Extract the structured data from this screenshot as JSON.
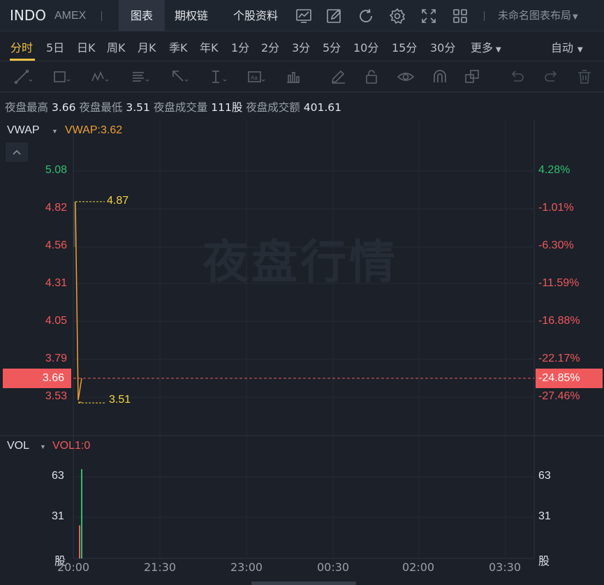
{
  "header": {
    "ticker": "INDO",
    "exchange": "AMEX",
    "tab_chart": "图表",
    "tab_options": "期权链",
    "tab_info": "个股资料",
    "icons": [
      "chart-line-icon",
      "pen-icon",
      "refresh-icon",
      "gear-icon",
      "fullscreen-icon",
      "grid-icon"
    ],
    "layout_label": "未命名图表布局"
  },
  "periods": {
    "items": [
      "分时",
      "5日",
      "日K",
      "周K",
      "月K",
      "季K",
      "年K",
      "1分",
      "2分",
      "3分",
      "5分",
      "10分",
      "15分",
      "30分",
      "更多"
    ],
    "active": "分时",
    "auto_label": "自动"
  },
  "draw_tools": [
    "trend-line-icon",
    "rectangle-icon",
    "pattern-icon",
    "fib-icon",
    "arrow-icon",
    "text-cursor-icon",
    "text-box-icon",
    "volume-profile-icon",
    "pencil-icon",
    "lock-icon",
    "eye-icon",
    "magnet-icon",
    "layers-icon",
    "undo-icon",
    "redo-icon",
    "trash-icon"
  ],
  "info": {
    "high_label": "夜盘最高",
    "high": "3.66",
    "low_label": "夜盘最低",
    "low": "3.51",
    "volume_label": "夜盘成交量",
    "volume": "111股",
    "turnover_label": "夜盘成交额",
    "turnover": "401.61"
  },
  "main_pane": {
    "indicator": "VWAP",
    "indicator_value": "VWAP:3.62",
    "watermark": "夜盘行情",
    "price_labels": [
      "5.08",
      "4.82",
      "4.56",
      "4.31",
      "4.05",
      "3.79",
      "3.53"
    ],
    "pct_labels": [
      "4.28%",
      "-1.01%",
      "-6.30%",
      "-11.59%",
      "-16.88%",
      "-22.17%",
      "-27.46%"
    ],
    "current_price": "3.66",
    "current_pct": "-24.85%",
    "high_marker": "4.87",
    "low_marker": "3.51"
  },
  "vol_pane": {
    "indicator": "VOL",
    "indicator_value": "VOL1:0",
    "labels": [
      "63",
      "31",
      "股"
    ]
  },
  "time_axis": [
    "20:00",
    "21:30",
    "23:00",
    "00:30",
    "02:00",
    "03:30"
  ],
  "colors": {
    "up": "#2fbf71",
    "down": "#f0595c",
    "accent": "#f5c242",
    "vwap": "#f0a030",
    "background": "#1b2029"
  },
  "chart_data": {
    "type": "line",
    "price_ylim": [
      3.53,
      5.08
    ],
    "points": [
      {
        "t": "20:00",
        "price": 4.87
      },
      {
        "t": "20:01",
        "price": 3.51
      },
      {
        "t": "20:02",
        "price": 3.66
      }
    ],
    "volume_bars": [
      {
        "t": "20:00",
        "value": 30,
        "color": "down"
      },
      {
        "t": "20:01",
        "value": 81,
        "color": "up"
      }
    ],
    "vol_ylim": [
      0,
      95
    ]
  }
}
